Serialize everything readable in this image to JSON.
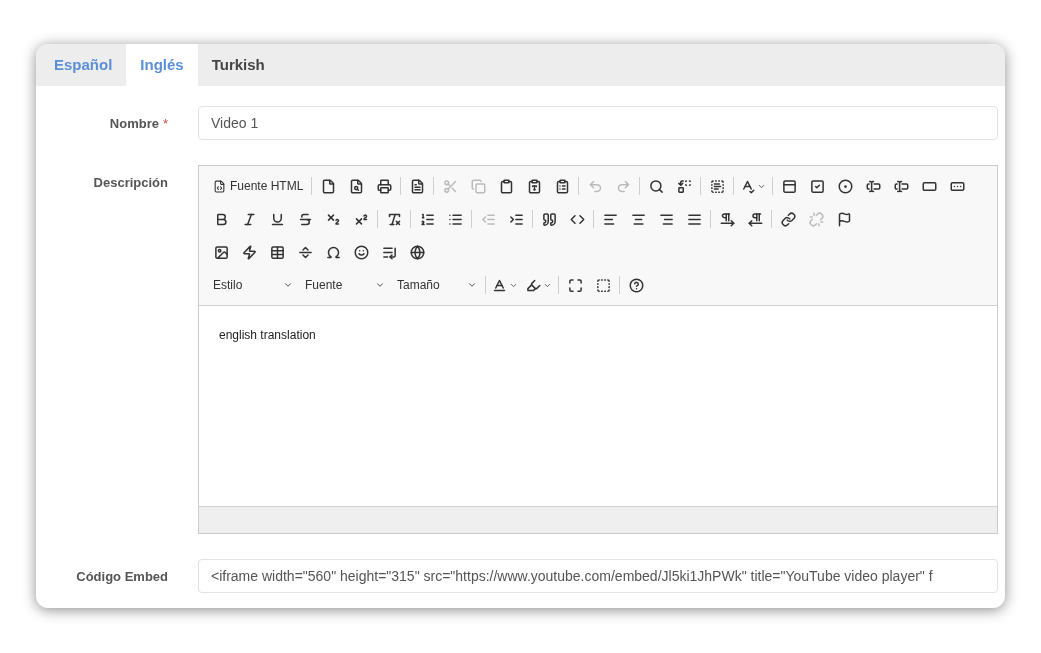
{
  "tabs": [
    {
      "label": "Español",
      "selected": false,
      "color": "#5b8fd6"
    },
    {
      "label": "Inglés",
      "selected": true,
      "color": "#5b8fd6"
    },
    {
      "label": "Turkish",
      "selected": false,
      "color": "#444444"
    }
  ],
  "form": {
    "name": {
      "label": "Nombre",
      "required_mark": "*",
      "value": "Video 1"
    },
    "description": {
      "label": "Descripción",
      "content": "english translation"
    },
    "embed": {
      "label": "Código Embed",
      "value": "<iframe width=\"560\" height=\"315\" src=\"https://www.youtube.com/embed/Jl5ki1JhPWk\" title=\"YouTube video player\" f"
    }
  },
  "toolbar": [
    [
      [
        {
          "kind": "labeled",
          "label": "Fuente HTML",
          "disabled": false
        }
      ],
      [
        {
          "kind": "icon",
          "disabled": false
        },
        {
          "kind": "icon",
          "disabled": false
        },
        {
          "kind": "icon",
          "disabled": false
        }
      ],
      [
        {
          "kind": "icon",
          "disabled": false
        }
      ],
      [
        {
          "kind": "icon",
          "disabled": true
        },
        {
          "kind": "icon",
          "disabled": true
        },
        {
          "kind": "icon",
          "disabled": false
        },
        {
          "kind": "icon",
          "disabled": false
        },
        {
          "kind": "icon",
          "disabled": false
        }
      ],
      [
        {
          "kind": "icon",
          "disabled": true
        },
        {
          "kind": "icon",
          "disabled": true
        }
      ],
      [
        {
          "kind": "icon",
          "disabled": false
        },
        {
          "kind": "icon",
          "disabled": false
        }
      ],
      [
        {
          "kind": "icon",
          "disabled": false
        }
      ],
      [
        {
          "kind": "menu",
          "disabled": false
        }
      ],
      [
        {
          "kind": "icon",
          "disabled": false
        },
        {
          "kind": "icon",
          "disabled": false
        },
        {
          "kind": "icon",
          "disabled": false
        },
        {
          "kind": "icon",
          "disabled": false
        },
        {
          "kind": "icon",
          "disabled": false
        },
        {
          "kind": "icon",
          "disabled": false
        },
        {
          "kind": "icon",
          "disabled": false
        }
      ]
    ],
    [
      [
        {
          "kind": "icon",
          "disabled": false
        },
        {
          "kind": "icon",
          "disabled": false
        },
        {
          "kind": "icon",
          "disabled": false
        },
        {
          "kind": "icon",
          "disabled": false
        },
        {
          "kind": "icon",
          "disabled": false
        },
        {
          "kind": "icon",
          "disabled": false
        }
      ],
      [
        {
          "kind": "icon",
          "disabled": false
        }
      ],
      [
        {
          "kind": "icon",
          "disabled": false
        },
        {
          "kind": "icon",
          "disabled": false
        }
      ],
      [
        {
          "kind": "icon",
          "disabled": true
        },
        {
          "kind": "icon",
          "disabled": false
        }
      ],
      [
        {
          "kind": "icon",
          "disabled": false
        },
        {
          "kind": "icon",
          "disabled": false
        }
      ],
      [
        {
          "kind": "icon",
          "disabled": false
        },
        {
          "kind": "icon",
          "disabled": false
        },
        {
          "kind": "icon",
          "disabled": false
        },
        {
          "kind": "icon",
          "disabled": false
        }
      ],
      [
        {
          "kind": "icon",
          "disabled": false
        },
        {
          "kind": "icon",
          "disabled": false
        }
      ],
      [
        {
          "kind": "icon",
          "disabled": false
        },
        {
          "kind": "icon",
          "disabled": true
        },
        {
          "kind": "icon",
          "disabled": false
        }
      ]
    ],
    [
      [
        {
          "kind": "icon",
          "disabled": false
        },
        {
          "kind": "icon",
          "disabled": false
        },
        {
          "kind": "icon",
          "disabled": false
        },
        {
          "kind": "icon",
          "disabled": false
        },
        {
          "kind": "icon",
          "disabled": false
        },
        {
          "kind": "icon",
          "disabled": false
        },
        {
          "kind": "icon",
          "disabled": false
        },
        {
          "kind": "icon",
          "disabled": false
        }
      ]
    ],
    [
      [
        {
          "kind": "combo",
          "label": "Estilo",
          "disabled": false
        },
        {
          "kind": "combo",
          "label": "Fuente",
          "disabled": false
        },
        {
          "kind": "combo",
          "label": "Tamaño",
          "disabled": false
        }
      ],
      [
        {
          "kind": "menu",
          "disabled": false
        },
        {
          "kind": "menu",
          "disabled": false
        }
      ],
      [
        {
          "kind": "icon",
          "disabled": false
        },
        {
          "kind": "icon",
          "disabled": false
        }
      ],
      [
        {
          "kind": "icon",
          "disabled": false
        }
      ]
    ]
  ]
}
